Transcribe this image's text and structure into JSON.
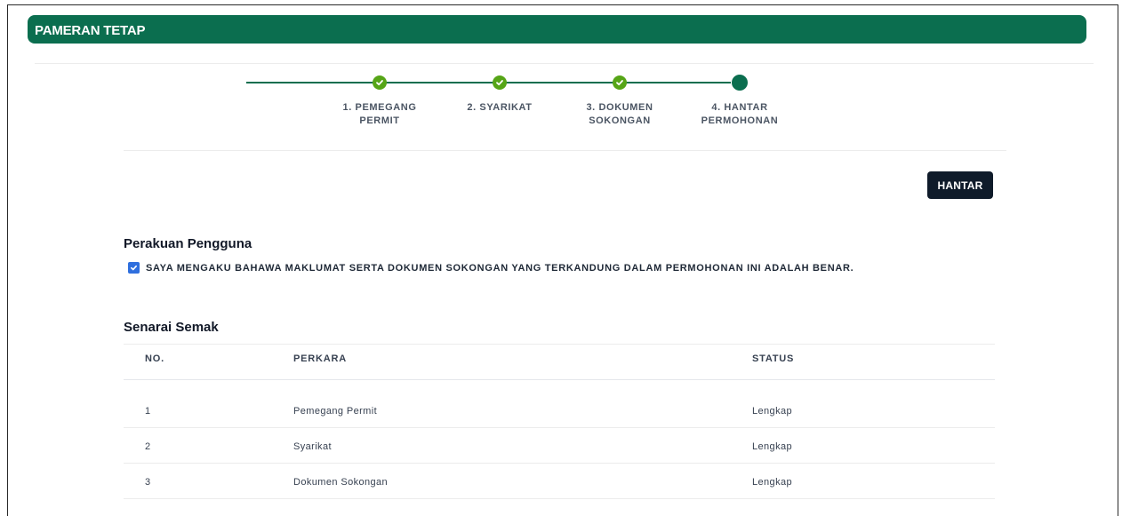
{
  "header": {
    "title": "PAMERAN TETAP"
  },
  "stepper": {
    "steps": [
      {
        "line1": "1. PEMEGANG",
        "line2": "PERMIT",
        "status": "complete"
      },
      {
        "line1": "2. SYARIKAT",
        "line2": "",
        "status": "complete"
      },
      {
        "line1": "3. DOKUMEN",
        "line2": "SOKONGAN",
        "status": "complete"
      },
      {
        "line1": "4. HANTAR",
        "line2": "PERMOHONAN",
        "status": "current"
      }
    ]
  },
  "actions": {
    "submit_label": "HANTAR"
  },
  "declaration": {
    "title": "Perakuan Pengguna",
    "checked": true,
    "text": "SAYA MENGAKU BAHAWA MAKLUMAT SERTA DOKUMEN SOKONGAN YANG TERKANDUNG DALAM PERMOHONAN INI ADALAH BENAR."
  },
  "checklist": {
    "title": "Senarai Semak",
    "columns": [
      "NO.",
      "PERKARA",
      "STATUS"
    ],
    "rows": [
      [
        "1",
        "Pemegang Permit",
        "Lengkap"
      ],
      [
        "2",
        "Syarikat",
        "Lengkap"
      ],
      [
        "3",
        "Dokumen Sokongan",
        "Lengkap"
      ]
    ]
  },
  "colors": {
    "brand": "#0b6e4f",
    "step_complete": "#56a517",
    "button_dark": "#0f1b2a",
    "checkbox": "#2f6fde"
  }
}
